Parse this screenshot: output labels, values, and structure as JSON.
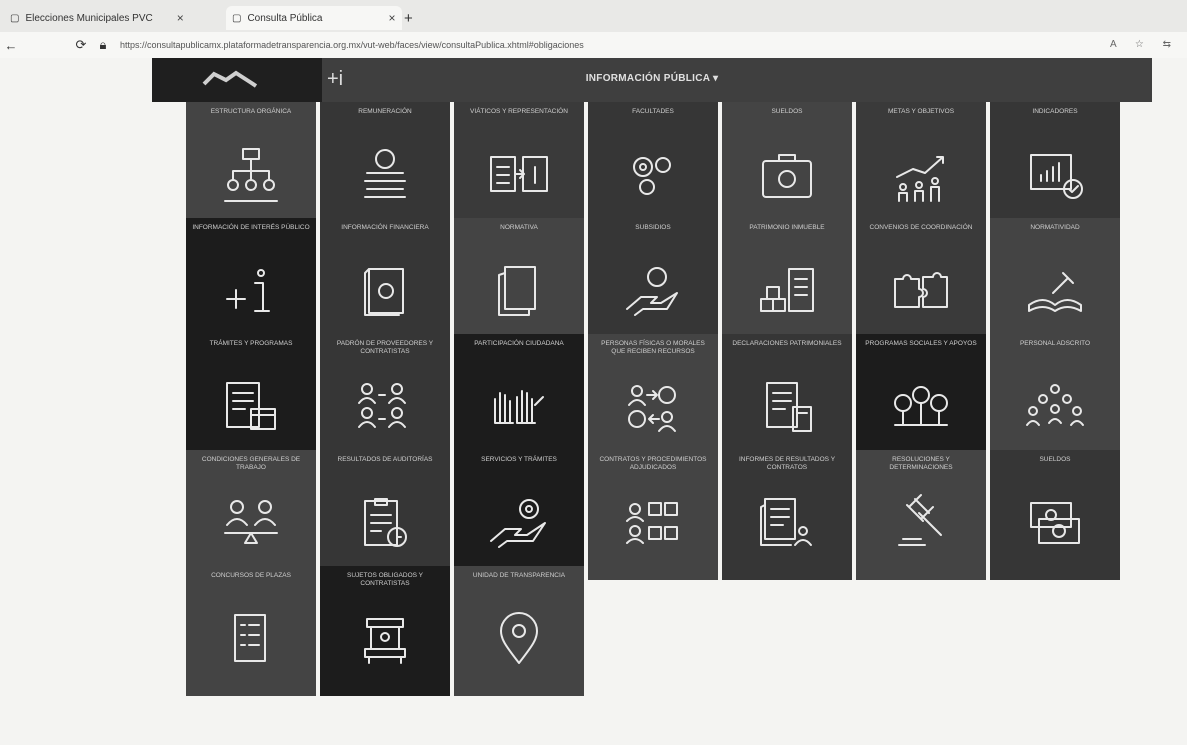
{
  "browser": {
    "tab1_label": "Elecciones Municipales PVC",
    "tab2_label": "Consulta Pública",
    "new_tab": "+",
    "url": "https://consultapublicamx.plataformadetransparencia.org.mx/vut-web/faces/view/consultaPublica.xhtml#obligaciones"
  },
  "header": {
    "title": "INFORMACIÓN PÚBLICA ▾",
    "plus_info": "+i"
  },
  "tiles": [
    {
      "label": "ESTRUCTURA ORGÁNICA",
      "icon": "org-chart-icon"
    },
    {
      "label": "REMUNERACIÓN",
      "icon": "coins-icon"
    },
    {
      "label": "VIÁTICOS Y REPRESENTACIÓN",
      "icon": "transfer-money-icon"
    },
    {
      "label": "FACULTADES",
      "icon": "gears-icon"
    },
    {
      "label": "SUELDOS",
      "icon": "briefcase-money-icon"
    },
    {
      "label": "METAS Y OBJETIVOS",
      "icon": "growth-people-icon"
    },
    {
      "label": "INDICADORES",
      "icon": "indicator-chart-icon"
    },
    {
      "label": "INFORMACIÓN DE INTERÉS PÚBLICO",
      "icon": "plus-info-icon"
    },
    {
      "label": "INFORMACIÓN FINANCIERA",
      "icon": "money-book-icon"
    },
    {
      "label": "NORMATIVA",
      "icon": "documents-icon"
    },
    {
      "label": "SUBSIDIOS",
      "icon": "hand-coin-icon"
    },
    {
      "label": "PATRIMONIO INMUEBLE",
      "icon": "inventory-icon"
    },
    {
      "label": "CONVENIOS DE COORDINACIÓN",
      "icon": "puzzle-icon"
    },
    {
      "label": "NORMATIVIDAD",
      "icon": "law-books-icon"
    },
    {
      "label": "TRÁMITES Y PROGRAMAS",
      "icon": "calendar-document-icon"
    },
    {
      "label": "PADRÓN DE PROVEEDORES Y CONTRATISTAS",
      "icon": "people-list-icon"
    },
    {
      "label": "PARTICIPACIÓN CIUDADANA",
      "icon": "raised-hands-icon"
    },
    {
      "label": "PERSONAS FÍSICAS O MORALES QUE RECIBEN RECURSOS",
      "icon": "people-exchange-icon"
    },
    {
      "label": "DECLARACIONES PATRIMONIALES",
      "icon": "document-calculator-icon"
    },
    {
      "label": "PROGRAMAS SOCIALES Y APOYOS",
      "icon": "money-trees-icon"
    },
    {
      "label": "PERSONAL ADSCRITO",
      "icon": "crowd-icon"
    },
    {
      "label": "CONDICIONES GENERALES DE TRABAJO",
      "icon": "balance-people-icon"
    },
    {
      "label": "RESULTADOS DE AUDITORÍAS",
      "icon": "clipboard-clock-icon"
    },
    {
      "label": "SERVICIOS Y TRÁMITES",
      "icon": "hand-gear-icon"
    },
    {
      "label": "CONTRATOS Y PROCEDIMIENTOS ADJUDICADOS",
      "icon": "people-checklist-icon"
    },
    {
      "label": "INFORMES DE RESULTADOS Y CONTRATOS",
      "icon": "reports-people-icon"
    },
    {
      "label": "RESOLUCIONES Y DETERMINACIONES",
      "icon": "gavel-icon"
    },
    {
      "label": "SUELDOS",
      "icon": "bills-icon"
    },
    {
      "label": "CONCURSOS DE PLAZAS",
      "icon": "checklist-icon"
    },
    {
      "label": "SUJETOS OBLIGADOS Y CONTRATISTAS",
      "icon": "kiosk-icon"
    },
    {
      "label": "UNIDAD DE TRANSPARENCIA",
      "icon": "location-pin-icon"
    }
  ]
}
